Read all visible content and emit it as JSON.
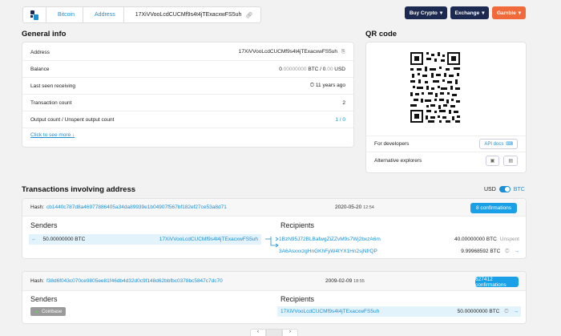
{
  "breadcrumb": [
    "Bitcoin",
    "Address",
    "17XiVVooLcdCUCMf9s4t4jTExacxwFS5uh"
  ],
  "nav": {
    "buy_crypto": "Buy Crypto",
    "exchange": "Exchange",
    "gamble": "Gamble",
    "colors": {
      "buy": "#1c2a52",
      "exchange": "#1c2a52",
      "gamble": "#f06a3c"
    }
  },
  "general_info": {
    "title": "General info",
    "rows": [
      {
        "label": "Address",
        "value": "17XiVVooLcdCUCMf9s4t4jTExacxwFS5uh"
      },
      {
        "label": "Balance",
        "value_zero": "0",
        "value_dim": ".00000000",
        "unit": "BTC / 0",
        "usd_dim": ".00",
        "usd": "USD"
      },
      {
        "label": "Last seen receiving",
        "value": "11 years ago"
      },
      {
        "label": "Transaction count",
        "value": "2"
      },
      {
        "label": "Output count / Unspent output count",
        "value": "1 / 0"
      }
    ],
    "see_more": "Click to see more"
  },
  "qr": {
    "title": "QR code",
    "for_developers": "For developers",
    "api_docs": "API docs",
    "alternative_explorers": "Alternative explorers"
  },
  "transactions": {
    "title": "Transactions involving address",
    "toggle_left": "USD",
    "toggle_right": "BTC",
    "items": [
      {
        "hash_label": "Hash:",
        "hash": "cb1440c787d8a46977886405a34da89939e1b04907f567bf182ef27ce53a8d71",
        "date": "2020-05-20",
        "time": "12:54",
        "confirmations": "8 confirmations",
        "senders_title": "Senders",
        "recipients_title": "Recipients",
        "sender_amount": "50.00000000 BTC",
        "sender_address": "17XiVVooLcdCUCMf9s4t4jTExacxwFS5uh",
        "recipients": [
          {
            "address": "1BzN95J72BLBafwgZiZZvM9s7Wj2bxzA6m",
            "amount": "40.00000000 BTC",
            "status": "Unspent"
          },
          {
            "address": "3A6AsxxxzgHnGKhFyW4tYX1Hn2sjNfrQP",
            "amount": "9.99968592 BTC",
            "status": ""
          }
        ]
      },
      {
        "hash_label": "Hash:",
        "hash": "f38d6f043c070ce9805ee81f46db4d32d0c9f148d62bbfbc0378bc5847c7dc70",
        "date": "2009-02-09",
        "time": "18:55",
        "confirmations": "627412 confirmations",
        "senders_title": "Senders",
        "recipients_title": "Recipients",
        "coinbase": "Coinbase",
        "recipient_address": "17XiVVooLcdCUCMf9s4t4jTExacxwFS5uh",
        "recipient_amount": "50.00000000 BTC"
      }
    ]
  }
}
